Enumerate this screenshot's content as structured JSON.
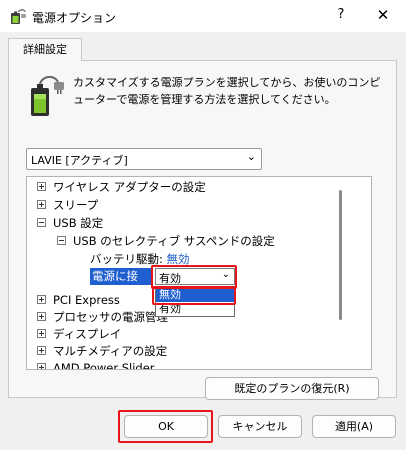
{
  "window": {
    "title": "電源オプション",
    "help_label": "?",
    "close_label": "✕",
    "icon": "power-options-icon"
  },
  "tabs": [
    {
      "label": "詳細設定"
    }
  ],
  "description": "カスタマイズする電源プランを選択してから、お使いのコンピューターで電源を管理する方法を選択してください。",
  "plan_select": {
    "value": "LAVIE [アクティブ]"
  },
  "tree": [
    {
      "label": "ワイヤレス アダプターの設定",
      "state": "collapsed"
    },
    {
      "label": "スリープ",
      "state": "collapsed"
    },
    {
      "label": "USB 設定",
      "state": "expanded"
    },
    {
      "label": "USB のセレクティブ サスペンドの設定",
      "state": "expanded"
    },
    {
      "label": "バッテリ駆動:",
      "value": "無効"
    },
    {
      "label": "電源に接続:",
      "value": "有効"
    },
    {
      "label": "PCI Express",
      "state": "collapsed"
    },
    {
      "label": "プロセッサの電源管理",
      "state": "collapsed"
    },
    {
      "label": "ディスプレイ",
      "state": "collapsed"
    },
    {
      "label": "マルチメディアの設定",
      "state": "collapsed"
    },
    {
      "label": "AMD Power Slider",
      "state": "collapsed"
    }
  ],
  "value_dropdown": {
    "selected": "有効",
    "options": [
      "無効",
      "有効"
    ],
    "highlighted": "無効"
  },
  "buttons": {
    "restore": "既定のプランの復元(R)",
    "ok": "OK",
    "cancel": "キャンセル",
    "apply": "適用(A)"
  },
  "colors": {
    "highlight": "#1e5ecf",
    "callout": "#e8141c",
    "value_link": "#1a57c6"
  }
}
